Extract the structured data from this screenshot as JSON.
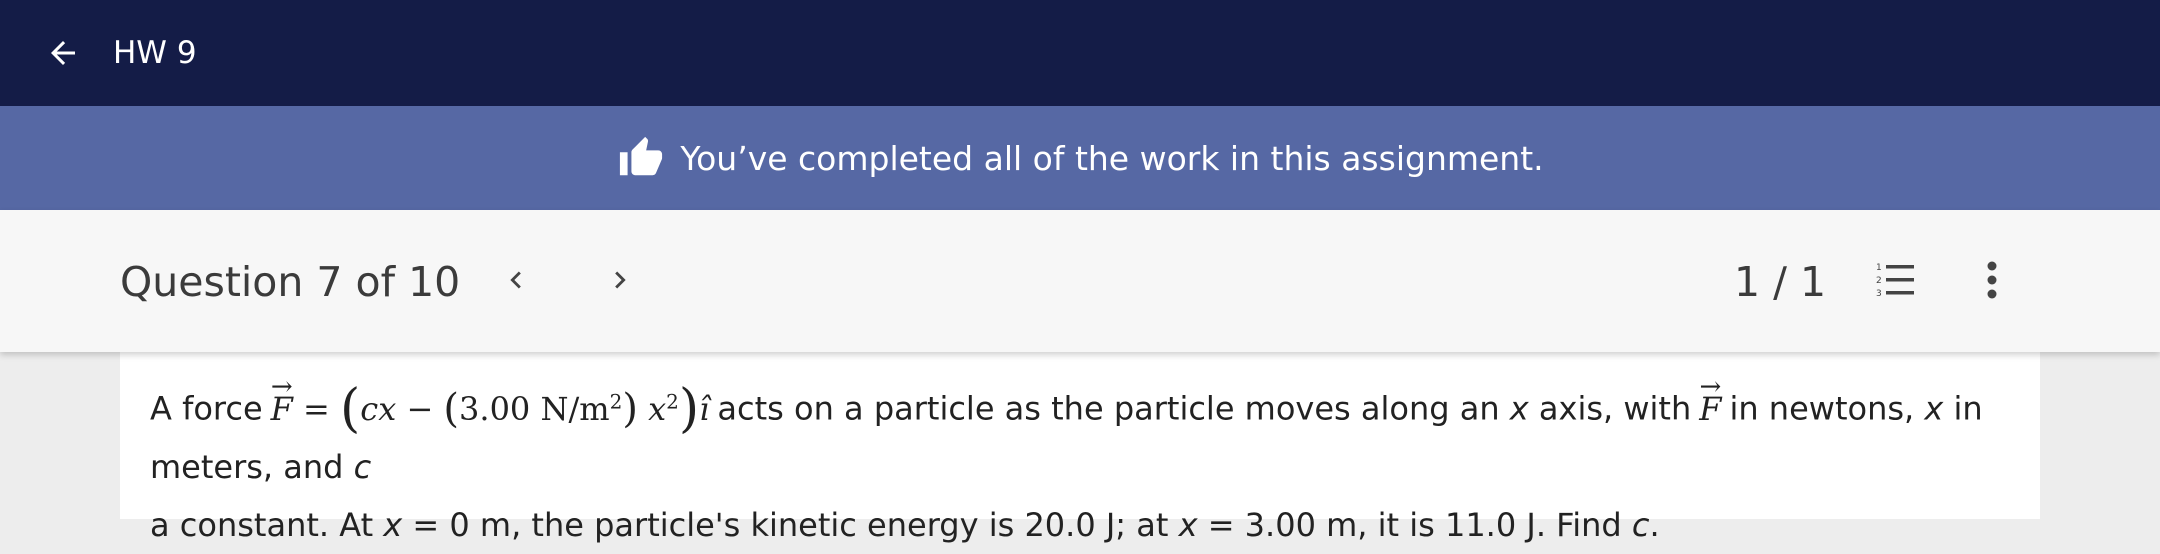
{
  "header": {
    "title": "HW 9",
    "back_icon": "arrow-left-icon",
    "background": "#141c47"
  },
  "banner": {
    "icon": "thumbs-up-icon",
    "message": "You’ve completed all of the work in this assignment.",
    "background": "#5668a4"
  },
  "question_nav": {
    "title": "Question 7 of 10",
    "prev_icon": "chevron-left-icon",
    "next_icon": "chevron-right-icon",
    "attempt_count": "1 / 1",
    "list_icon": "numbered-list-icon",
    "more_icon": "more-vertical-icon"
  },
  "question": {
    "intro": "A force",
    "F": "F",
    "equals": "=",
    "cx": "cx",
    "minus": "−",
    "coef": "3.00 N/m",
    "coef_exp": "2",
    "x": "x",
    "x_exp": "2",
    "unit_vec": "î",
    "after_formula": "acts on a particle as the particle moves along an ",
    "x_axis": "x",
    "axis_text": " axis, with",
    "F2": "F",
    "in_newtons": "in newtons, ",
    "x_meters": "x",
    "meters_text": " in meters, and ",
    "c1": "c",
    "line2_a": "a constant. At ",
    "x0": "x",
    "line2_b": " = 0 m, the particle's kinetic energy is 20.0 J; at ",
    "x3": "x",
    "line2_c": " = 3.00 m, it is 11.0 J. Find ",
    "c2": "c",
    "end": "."
  }
}
